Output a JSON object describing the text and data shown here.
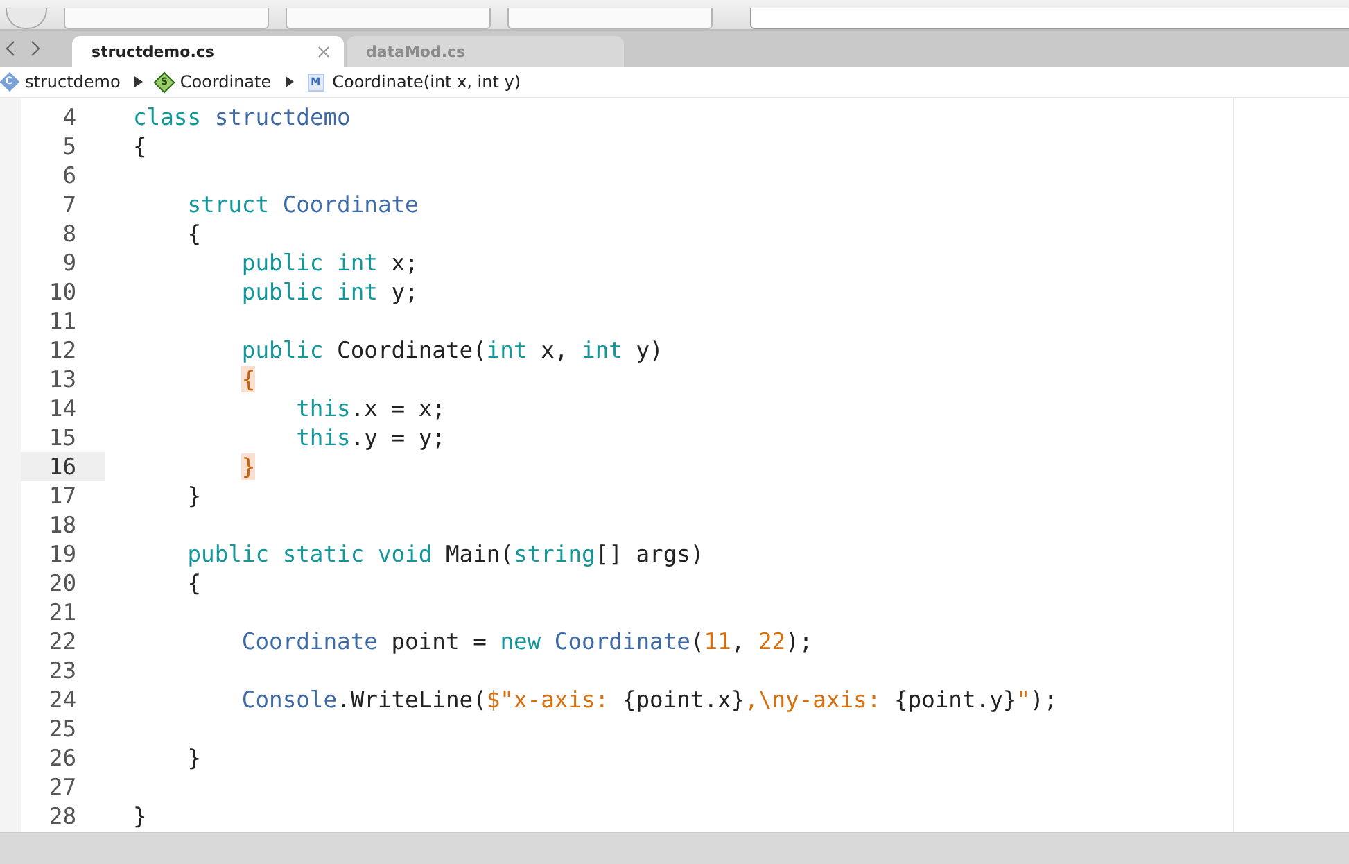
{
  "tabs": [
    {
      "label": "structdemo.cs",
      "selected": true
    },
    {
      "label": "dataMod.cs",
      "selected": false
    }
  ],
  "breadcrumb": [
    {
      "label": "structdemo",
      "kind": "class",
      "badge": "C"
    },
    {
      "label": "Coordinate",
      "kind": "struct",
      "badge": "S"
    },
    {
      "label": "Coordinate(int x, int y)",
      "kind": "method",
      "badge": "M"
    }
  ],
  "lines": [
    {
      "number": "4",
      "current": false,
      "tokens": [
        {
          "text": "class ",
          "kind": "keyword"
        },
        {
          "text": "structdemo",
          "kind": "type"
        }
      ]
    },
    {
      "number": "5",
      "current": false,
      "tokens": [
        {
          "text": "{",
          "kind": "plain"
        }
      ]
    },
    {
      "number": "6",
      "current": false
    },
    {
      "number": "7",
      "current": false,
      "tokens": [
        {
          "text": "    struct ",
          "kind": "keyword"
        },
        {
          "text": "Coordinate",
          "kind": "type"
        }
      ]
    },
    {
      "number": "8",
      "current": false,
      "tokens": [
        {
          "text": "    {",
          "kind": "plain"
        }
      ]
    },
    {
      "number": "9",
      "current": false,
      "tokens": [
        {
          "text": "        public int",
          "kind": "keyword"
        },
        {
          "text": " x;",
          "kind": "plain"
        }
      ]
    },
    {
      "number": "10",
      "current": false,
      "tokens": [
        {
          "text": "        public int",
          "kind": "keyword"
        },
        {
          "text": " y;",
          "kind": "plain"
        }
      ]
    },
    {
      "number": "11",
      "current": false
    },
    {
      "number": "12",
      "current": false,
      "tokens": [
        {
          "text": "        public",
          "kind": "keyword"
        },
        {
          "text": " Coordinate(",
          "kind": "plain"
        },
        {
          "text": "int",
          "kind": "keyword"
        },
        {
          "text": " x, ",
          "kind": "plain"
        },
        {
          "text": "int",
          "kind": "keyword"
        },
        {
          "text": " y)",
          "kind": "plain"
        }
      ]
    },
    {
      "number": "13",
      "current": false,
      "tokens": [
        {
          "text": "        {",
          "kind": "brace_match"
        }
      ]
    },
    {
      "number": "14",
      "current": false,
      "tokens": [
        {
          "text": "            this",
          "kind": "keyword"
        },
        {
          "text": ".x = x;",
          "kind": "plain"
        }
      ]
    },
    {
      "number": "15",
      "current": false,
      "tokens": [
        {
          "text": "            this",
          "kind": "keyword"
        },
        {
          "text": ".y = y;",
          "kind": "plain"
        }
      ]
    },
    {
      "number": "16",
      "current": true,
      "tokens": [
        {
          "text": "        }",
          "kind": "brace_match"
        }
      ]
    },
    {
      "number": "17",
      "current": false,
      "tokens": [
        {
          "text": "    }",
          "kind": "plain"
        }
      ]
    },
    {
      "number": "18",
      "current": false
    },
    {
      "number": "19",
      "current": false,
      "tokens": [
        {
          "text": "    public static void",
          "kind": "keyword"
        },
        {
          "text": " Main(",
          "kind": "plain"
        },
        {
          "text": "string",
          "kind": "keyword"
        },
        {
          "text": "[] args)",
          "kind": "plain"
        }
      ]
    },
    {
      "number": "20",
      "current": false,
      "tokens": [
        {
          "text": "    {",
          "kind": "plain"
        }
      ]
    },
    {
      "number": "21",
      "current": false
    },
    {
      "number": "22",
      "current": false,
      "tokens": [
        {
          "text": "        Coordinate",
          "kind": "type"
        },
        {
          "text": " point = ",
          "kind": "plain"
        },
        {
          "text": "new ",
          "kind": "keyword"
        },
        {
          "text": "Coordinate",
          "kind": "type"
        },
        {
          "text": "(",
          "kind": "plain"
        },
        {
          "text": "11",
          "kind": "number"
        },
        {
          "text": ", ",
          "kind": "plain"
        },
        {
          "text": "22",
          "kind": "number"
        },
        {
          "text": ");",
          "kind": "plain"
        }
      ]
    },
    {
      "number": "23",
      "current": false
    },
    {
      "number": "24",
      "current": false,
      "tokens": [
        {
          "text": "        Console",
          "kind": "type"
        },
        {
          "text": ".WriteLine(",
          "kind": "plain"
        },
        {
          "text": "$\"x-axis: ",
          "kind": "string"
        },
        {
          "text": "{point.x}",
          "kind": "plain"
        },
        {
          "text": ",\\ny-axis: ",
          "kind": "string"
        },
        {
          "text": "{point.y}",
          "kind": "plain"
        },
        {
          "text": "\"",
          "kind": "string"
        },
        {
          "text": ");",
          "kind": "plain"
        }
      ]
    },
    {
      "number": "25",
      "current": false
    },
    {
      "number": "26",
      "current": false,
      "tokens": [
        {
          "text": "    }",
          "kind": "plain"
        }
      ]
    },
    {
      "number": "27",
      "current": false
    },
    {
      "number": "28",
      "current": false,
      "tokens": [
        {
          "text": "}",
          "kind": "plain"
        }
      ]
    }
  ]
}
